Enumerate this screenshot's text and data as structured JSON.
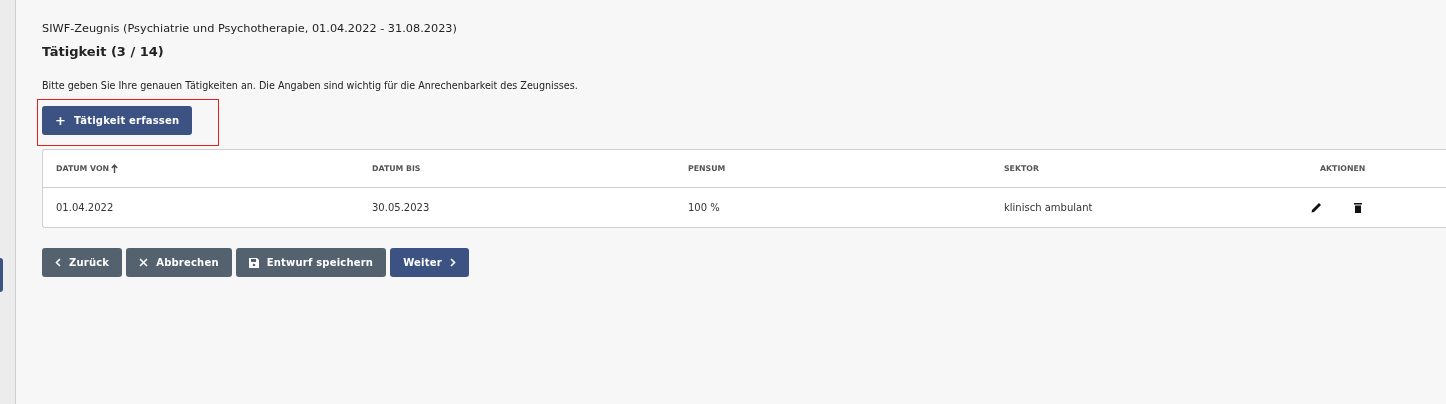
{
  "breadcrumb": "SIWF-Zeugnis (Psychiatrie und Psychotherapie, 01.04.2022 - 31.08.2023)",
  "heading": "Tätigkeit (3 / 14)",
  "description": "Bitte geben Sie Ihre genauen Tätigkeiten an. Die Angaben sind wichtig für die Anrechenbarkeit des Zeugnisses.",
  "add_button": {
    "icon": "+",
    "label": "Tätigkeit erfassen",
    "highlighted": true
  },
  "table": {
    "columns": [
      {
        "label": "DATUM VON",
        "sorted": true
      },
      {
        "label": "DATUM BIS",
        "sorted": false
      },
      {
        "label": "PENSUM",
        "sorted": false
      },
      {
        "label": "SEKTOR",
        "sorted": false
      },
      {
        "label": "AKTIONEN",
        "sorted": false
      }
    ],
    "rows": [
      {
        "cells": [
          "01.04.2022",
          "30.05.2023",
          "100 %",
          "klinisch ambulant"
        ]
      }
    ]
  },
  "buttons": [
    {
      "kind": "back",
      "label": "Zurück",
      "primary": false
    },
    {
      "kind": "cancel",
      "label": "Abbrechen",
      "primary": false
    },
    {
      "kind": "save",
      "label": "Entwurf speichern",
      "primary": false
    },
    {
      "kind": "next",
      "label": "Weiter",
      "primary": true
    }
  ]
}
